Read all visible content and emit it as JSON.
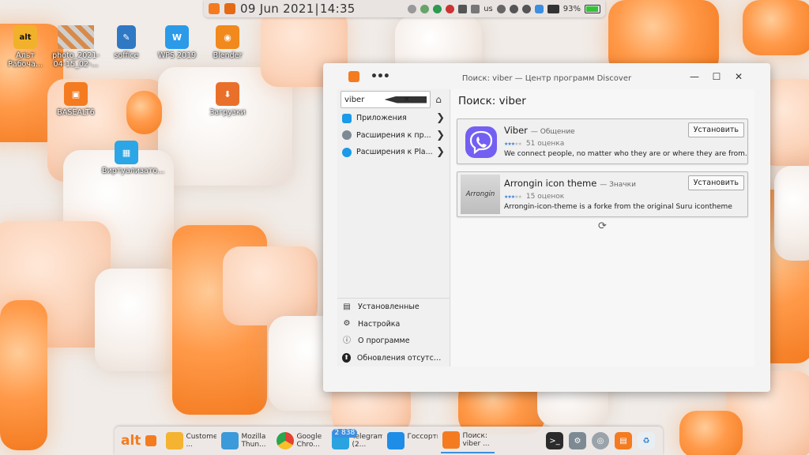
{
  "topbar": {
    "date": "09 Jun 2021",
    "time": "14:35",
    "keyboard_layout": "us",
    "battery_percent": "93%",
    "battery_level": 0.93
  },
  "desktop_icons": [
    {
      "label": "Альт Рабоча...",
      "icon": "alt-base-icon"
    },
    {
      "label": "photo_2021-04-15_02-...",
      "icon": "image-thumbnail-icon"
    },
    {
      "label": "soffice",
      "icon": "soffice-icon"
    },
    {
      "label": "WPS 2019",
      "icon": "wps-icon"
    },
    {
      "label": "Blender",
      "icon": "blender-icon"
    },
    {
      "label": "BASEALT6",
      "icon": "basealt-icon"
    },
    {
      "label": "Загрузки",
      "icon": "downloads-folder-icon"
    },
    {
      "label": "Виртуализато...",
      "icon": "virtualization-icon"
    }
  ],
  "window": {
    "title": "Поиск: viber — Центр программ Discover",
    "search_value": "viber",
    "categories": [
      {
        "label": "Приложения",
        "color": "#1a9ae8"
      },
      {
        "label": "Расширения к пр...",
        "color": "#7d8a93"
      },
      {
        "label": "Расширения к Pla...",
        "color": "#1a9ae8"
      }
    ],
    "bottom_nav": [
      {
        "label": "Установленные",
        "icon": "▤"
      },
      {
        "label": "Настройка",
        "icon": "⚙"
      },
      {
        "label": "О программе",
        "icon": "ⓘ"
      },
      {
        "label": "Обновления отсутству...",
        "icon": "⬆"
      }
    ],
    "page_title": "Поиск: viber",
    "results": [
      {
        "name": "Viber",
        "category": "— Общение",
        "rating_text": "51 оценка",
        "stars": 3,
        "description": "We connect people, no matter who they are or where they are from.",
        "button": "Установить"
      },
      {
        "name": "Arrongin icon theme",
        "category": "— Значки",
        "rating_text": "15 оценок",
        "stars": 3,
        "description": "Arrongin-icon-theme is a  forke from the original Suru icontheme",
        "button": "Установить",
        "logo_text": "Arrongin"
      }
    ]
  },
  "taskbar": {
    "logo": "alt",
    "tasks": [
      {
        "label": "Customers ...",
        "color": "#f4b331"
      },
      {
        "label": "Mozilla Thun...",
        "color": "#3b9ad9"
      },
      {
        "label": "Google Chro...",
        "color": "#e24133"
      },
      {
        "label": "Telegram (2...",
        "color": "#2aa3e0",
        "badge": "2 838"
      },
      {
        "label": "Госсортко...",
        "color": "#1e8de8"
      },
      {
        "label": "Поиск: viber ...",
        "color": "#f47b20",
        "active": true
      }
    ]
  }
}
